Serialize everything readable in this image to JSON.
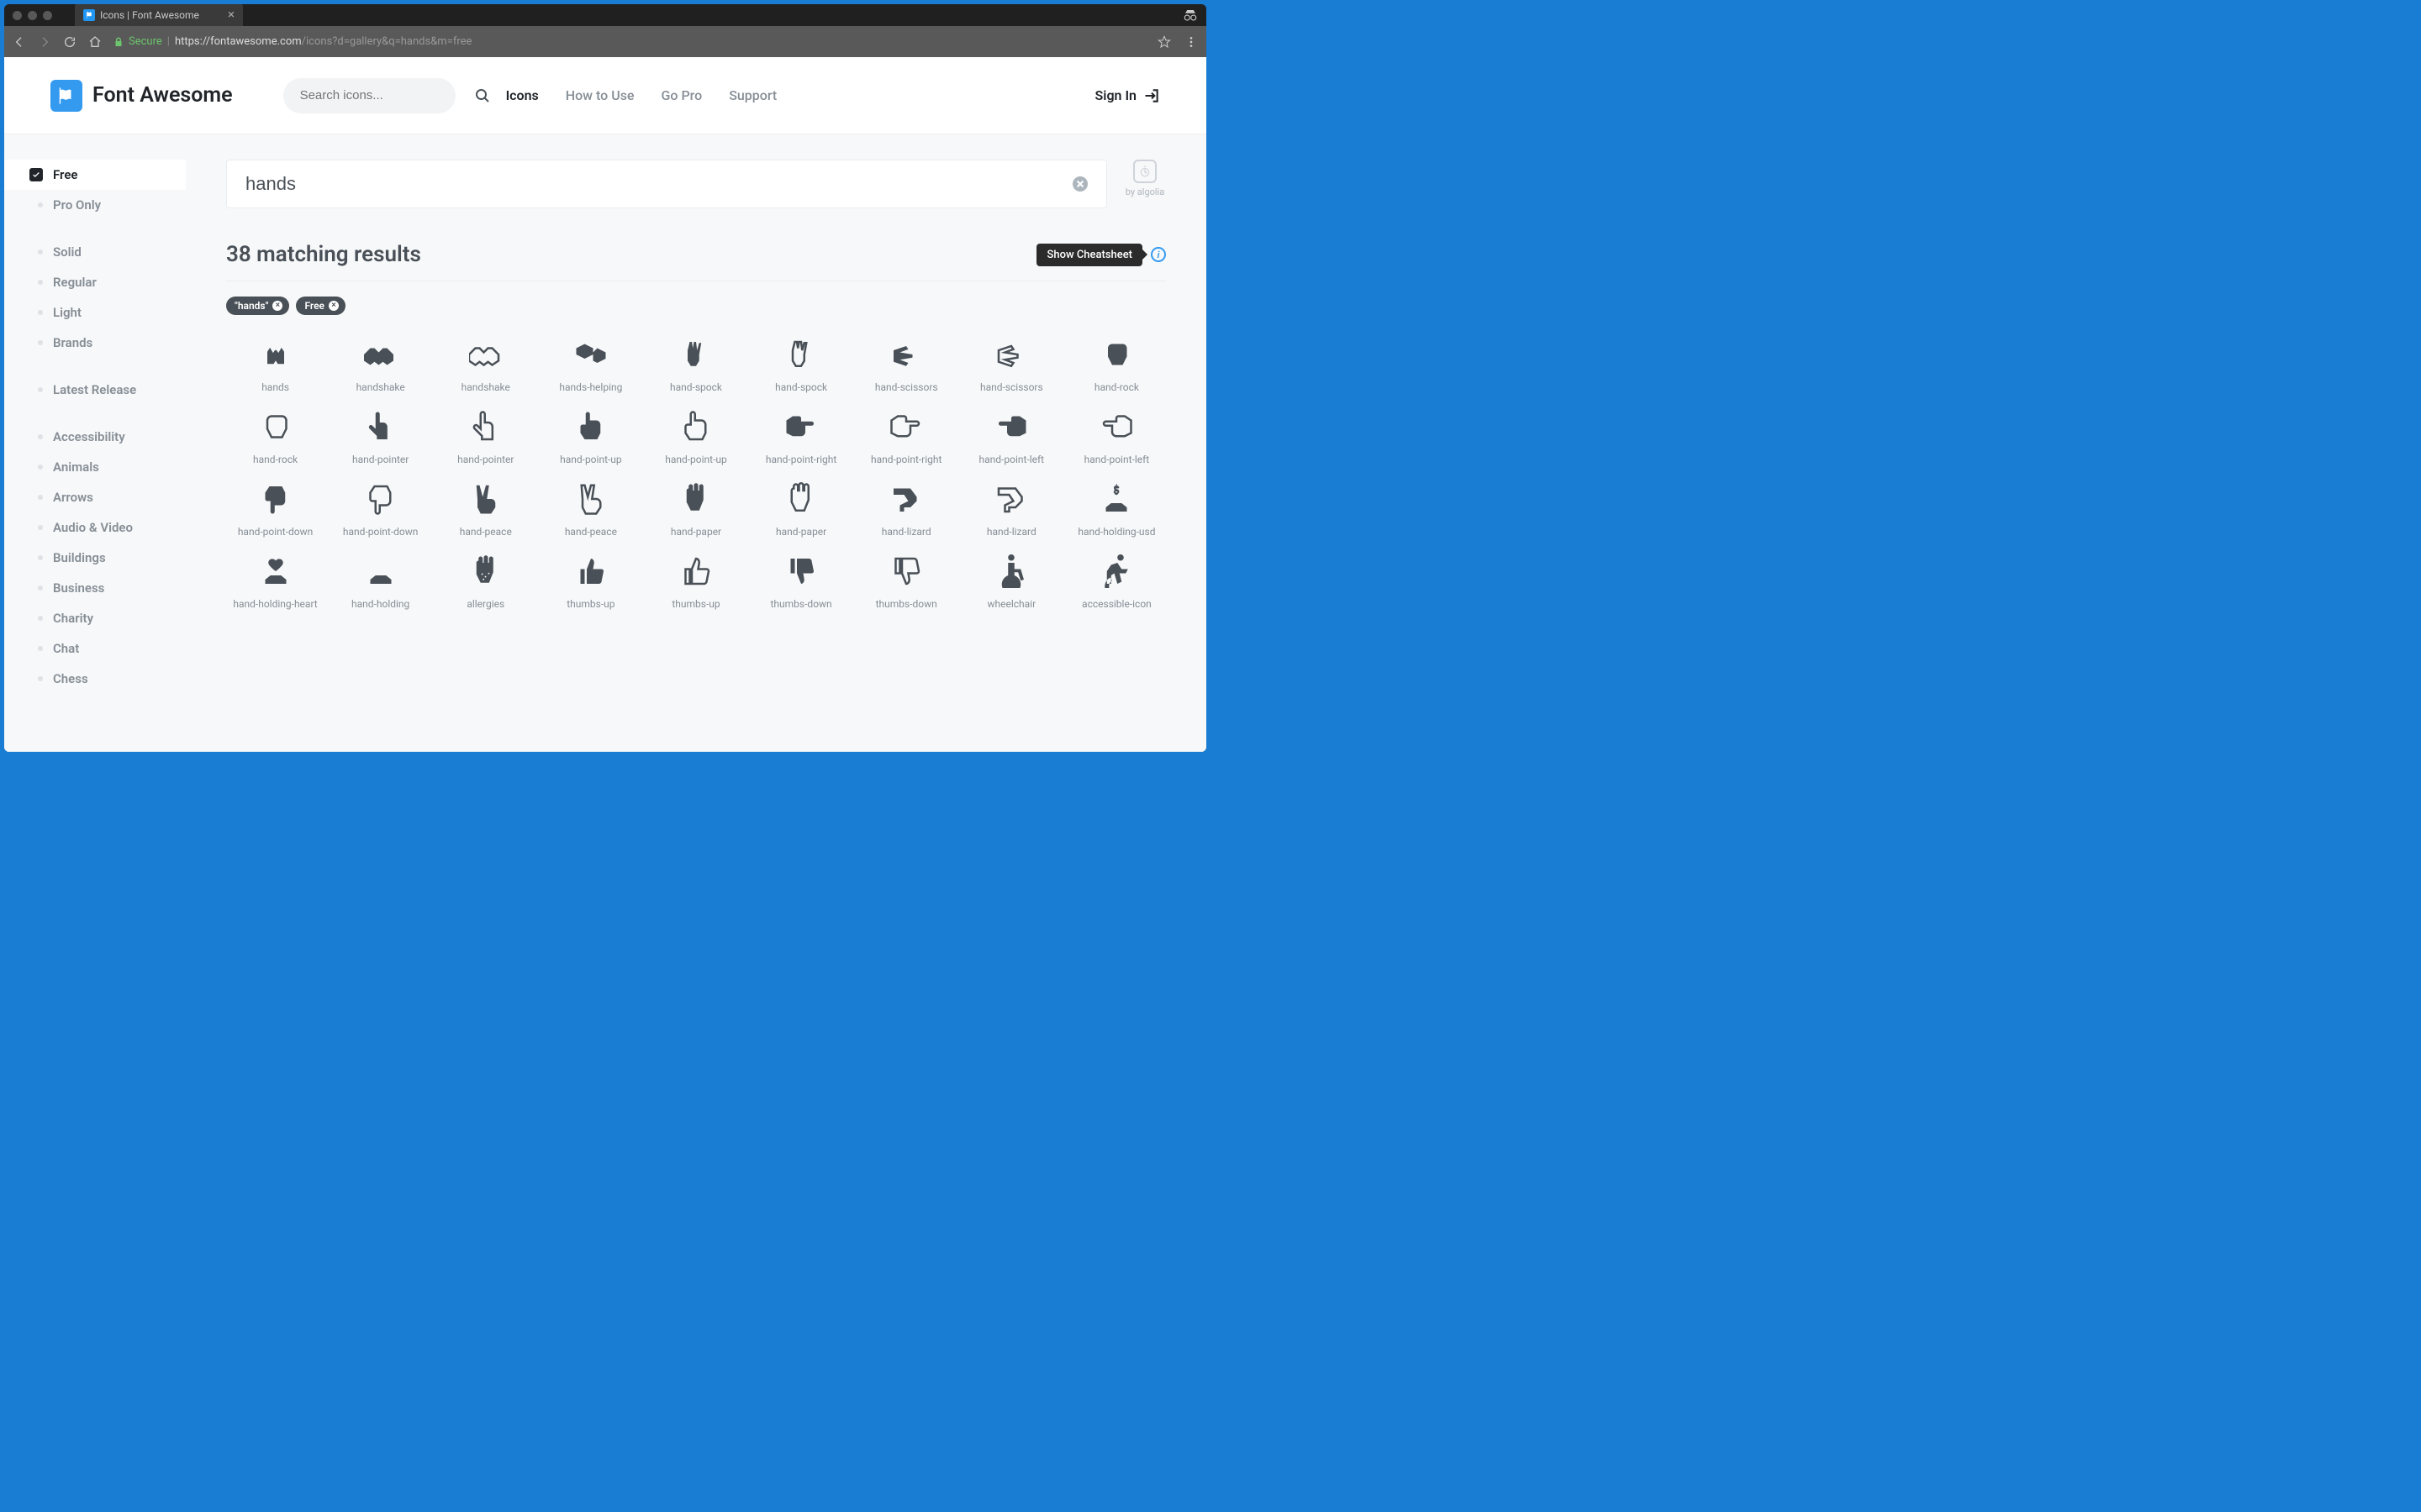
{
  "browser": {
    "tab_title": "Icons | Font Awesome",
    "secure_label": "Secure",
    "url_host": "https://fontawesome.com",
    "url_path": "/icons?d=gallery&q=hands&m=free"
  },
  "header": {
    "brand": "Font Awesome",
    "search_placeholder": "Search icons...",
    "nav": [
      {
        "label": "Icons",
        "active": true
      },
      {
        "label": "How to Use",
        "active": false
      },
      {
        "label": "Go Pro",
        "active": false
      },
      {
        "label": "Support",
        "active": false
      }
    ],
    "signin_label": "Sign In"
  },
  "sidebar": {
    "groups": [
      [
        {
          "label": "Free",
          "active": true
        },
        {
          "label": "Pro Only",
          "active": false
        }
      ],
      [
        {
          "label": "Solid",
          "active": false
        },
        {
          "label": "Regular",
          "active": false
        },
        {
          "label": "Light",
          "active": false
        },
        {
          "label": "Brands",
          "active": false
        }
      ],
      [
        {
          "label": "Latest Release",
          "active": false
        }
      ],
      [
        {
          "label": "Accessibility",
          "active": false
        },
        {
          "label": "Animals",
          "active": false
        },
        {
          "label": "Arrows",
          "active": false
        },
        {
          "label": "Audio & Video",
          "active": false
        },
        {
          "label": "Buildings",
          "active": false
        },
        {
          "label": "Business",
          "active": false
        },
        {
          "label": "Charity",
          "active": false
        },
        {
          "label": "Chat",
          "active": false
        },
        {
          "label": "Chess",
          "active": false
        }
      ]
    ]
  },
  "main": {
    "search_value": "hands",
    "algolia_label": "by algolia",
    "results_count_text": "38 matching results",
    "cheatsheet_label": "Show Cheatsheet",
    "chips": [
      "\"hands\"",
      "Free"
    ],
    "icons": [
      {
        "name": "hands",
        "svg": "hands",
        "style": "solid"
      },
      {
        "name": "handshake",
        "svg": "handshake",
        "style": "solid"
      },
      {
        "name": "handshake",
        "svg": "handshake",
        "style": "outline"
      },
      {
        "name": "hands-helping",
        "svg": "hands-helping",
        "style": "solid"
      },
      {
        "name": "hand-spock",
        "svg": "hand-spock",
        "style": "solid"
      },
      {
        "name": "hand-spock",
        "svg": "hand-spock",
        "style": "outline"
      },
      {
        "name": "hand-scissors",
        "svg": "hand-scissors",
        "style": "solid"
      },
      {
        "name": "hand-scissors",
        "svg": "hand-scissors",
        "style": "outline"
      },
      {
        "name": "hand-rock",
        "svg": "hand-rock",
        "style": "solid"
      },
      {
        "name": "hand-rock",
        "svg": "hand-rock",
        "style": "outline"
      },
      {
        "name": "hand-pointer",
        "svg": "hand-pointer",
        "style": "solid"
      },
      {
        "name": "hand-pointer",
        "svg": "hand-pointer",
        "style": "outline"
      },
      {
        "name": "hand-point-up",
        "svg": "hand-point-up",
        "style": "solid"
      },
      {
        "name": "hand-point-up",
        "svg": "hand-point-up",
        "style": "outline"
      },
      {
        "name": "hand-point-right",
        "svg": "hand-point-right",
        "style": "solid"
      },
      {
        "name": "hand-point-right",
        "svg": "hand-point-right",
        "style": "outline"
      },
      {
        "name": "hand-point-left",
        "svg": "hand-point-left",
        "style": "solid"
      },
      {
        "name": "hand-point-left",
        "svg": "hand-point-left",
        "style": "outline"
      },
      {
        "name": "hand-point-down",
        "svg": "hand-point-down",
        "style": "solid"
      },
      {
        "name": "hand-point-down",
        "svg": "hand-point-down",
        "style": "outline"
      },
      {
        "name": "hand-peace",
        "svg": "hand-peace",
        "style": "solid"
      },
      {
        "name": "hand-peace",
        "svg": "hand-peace",
        "style": "outline"
      },
      {
        "name": "hand-paper",
        "svg": "hand-paper",
        "style": "solid"
      },
      {
        "name": "hand-paper",
        "svg": "hand-paper",
        "style": "outline"
      },
      {
        "name": "hand-lizard",
        "svg": "hand-lizard",
        "style": "solid"
      },
      {
        "name": "hand-lizard",
        "svg": "hand-lizard",
        "style": "outline"
      },
      {
        "name": "hand-holding-usd",
        "svg": "hand-holding-usd",
        "style": "solid"
      },
      {
        "name": "hand-holding-heart",
        "svg": "hand-holding-heart",
        "style": "solid"
      },
      {
        "name": "hand-holding",
        "svg": "hand-holding",
        "style": "solid"
      },
      {
        "name": "allergies",
        "svg": "allergies",
        "style": "solid"
      },
      {
        "name": "thumbs-up",
        "svg": "thumbs-up",
        "style": "solid"
      },
      {
        "name": "thumbs-up",
        "svg": "thumbs-up",
        "style": "outline"
      },
      {
        "name": "thumbs-down",
        "svg": "thumbs-down",
        "style": "solid"
      },
      {
        "name": "thumbs-down",
        "svg": "thumbs-down",
        "style": "outline"
      },
      {
        "name": "wheelchair",
        "svg": "wheelchair",
        "style": "solid"
      },
      {
        "name": "accessible-icon",
        "svg": "accessible-icon",
        "style": "solid"
      }
    ]
  },
  "colors": {
    "accent": "#339af0",
    "text_dark": "#212529",
    "text_mid": "#495057",
    "text_muted": "#868e96"
  }
}
